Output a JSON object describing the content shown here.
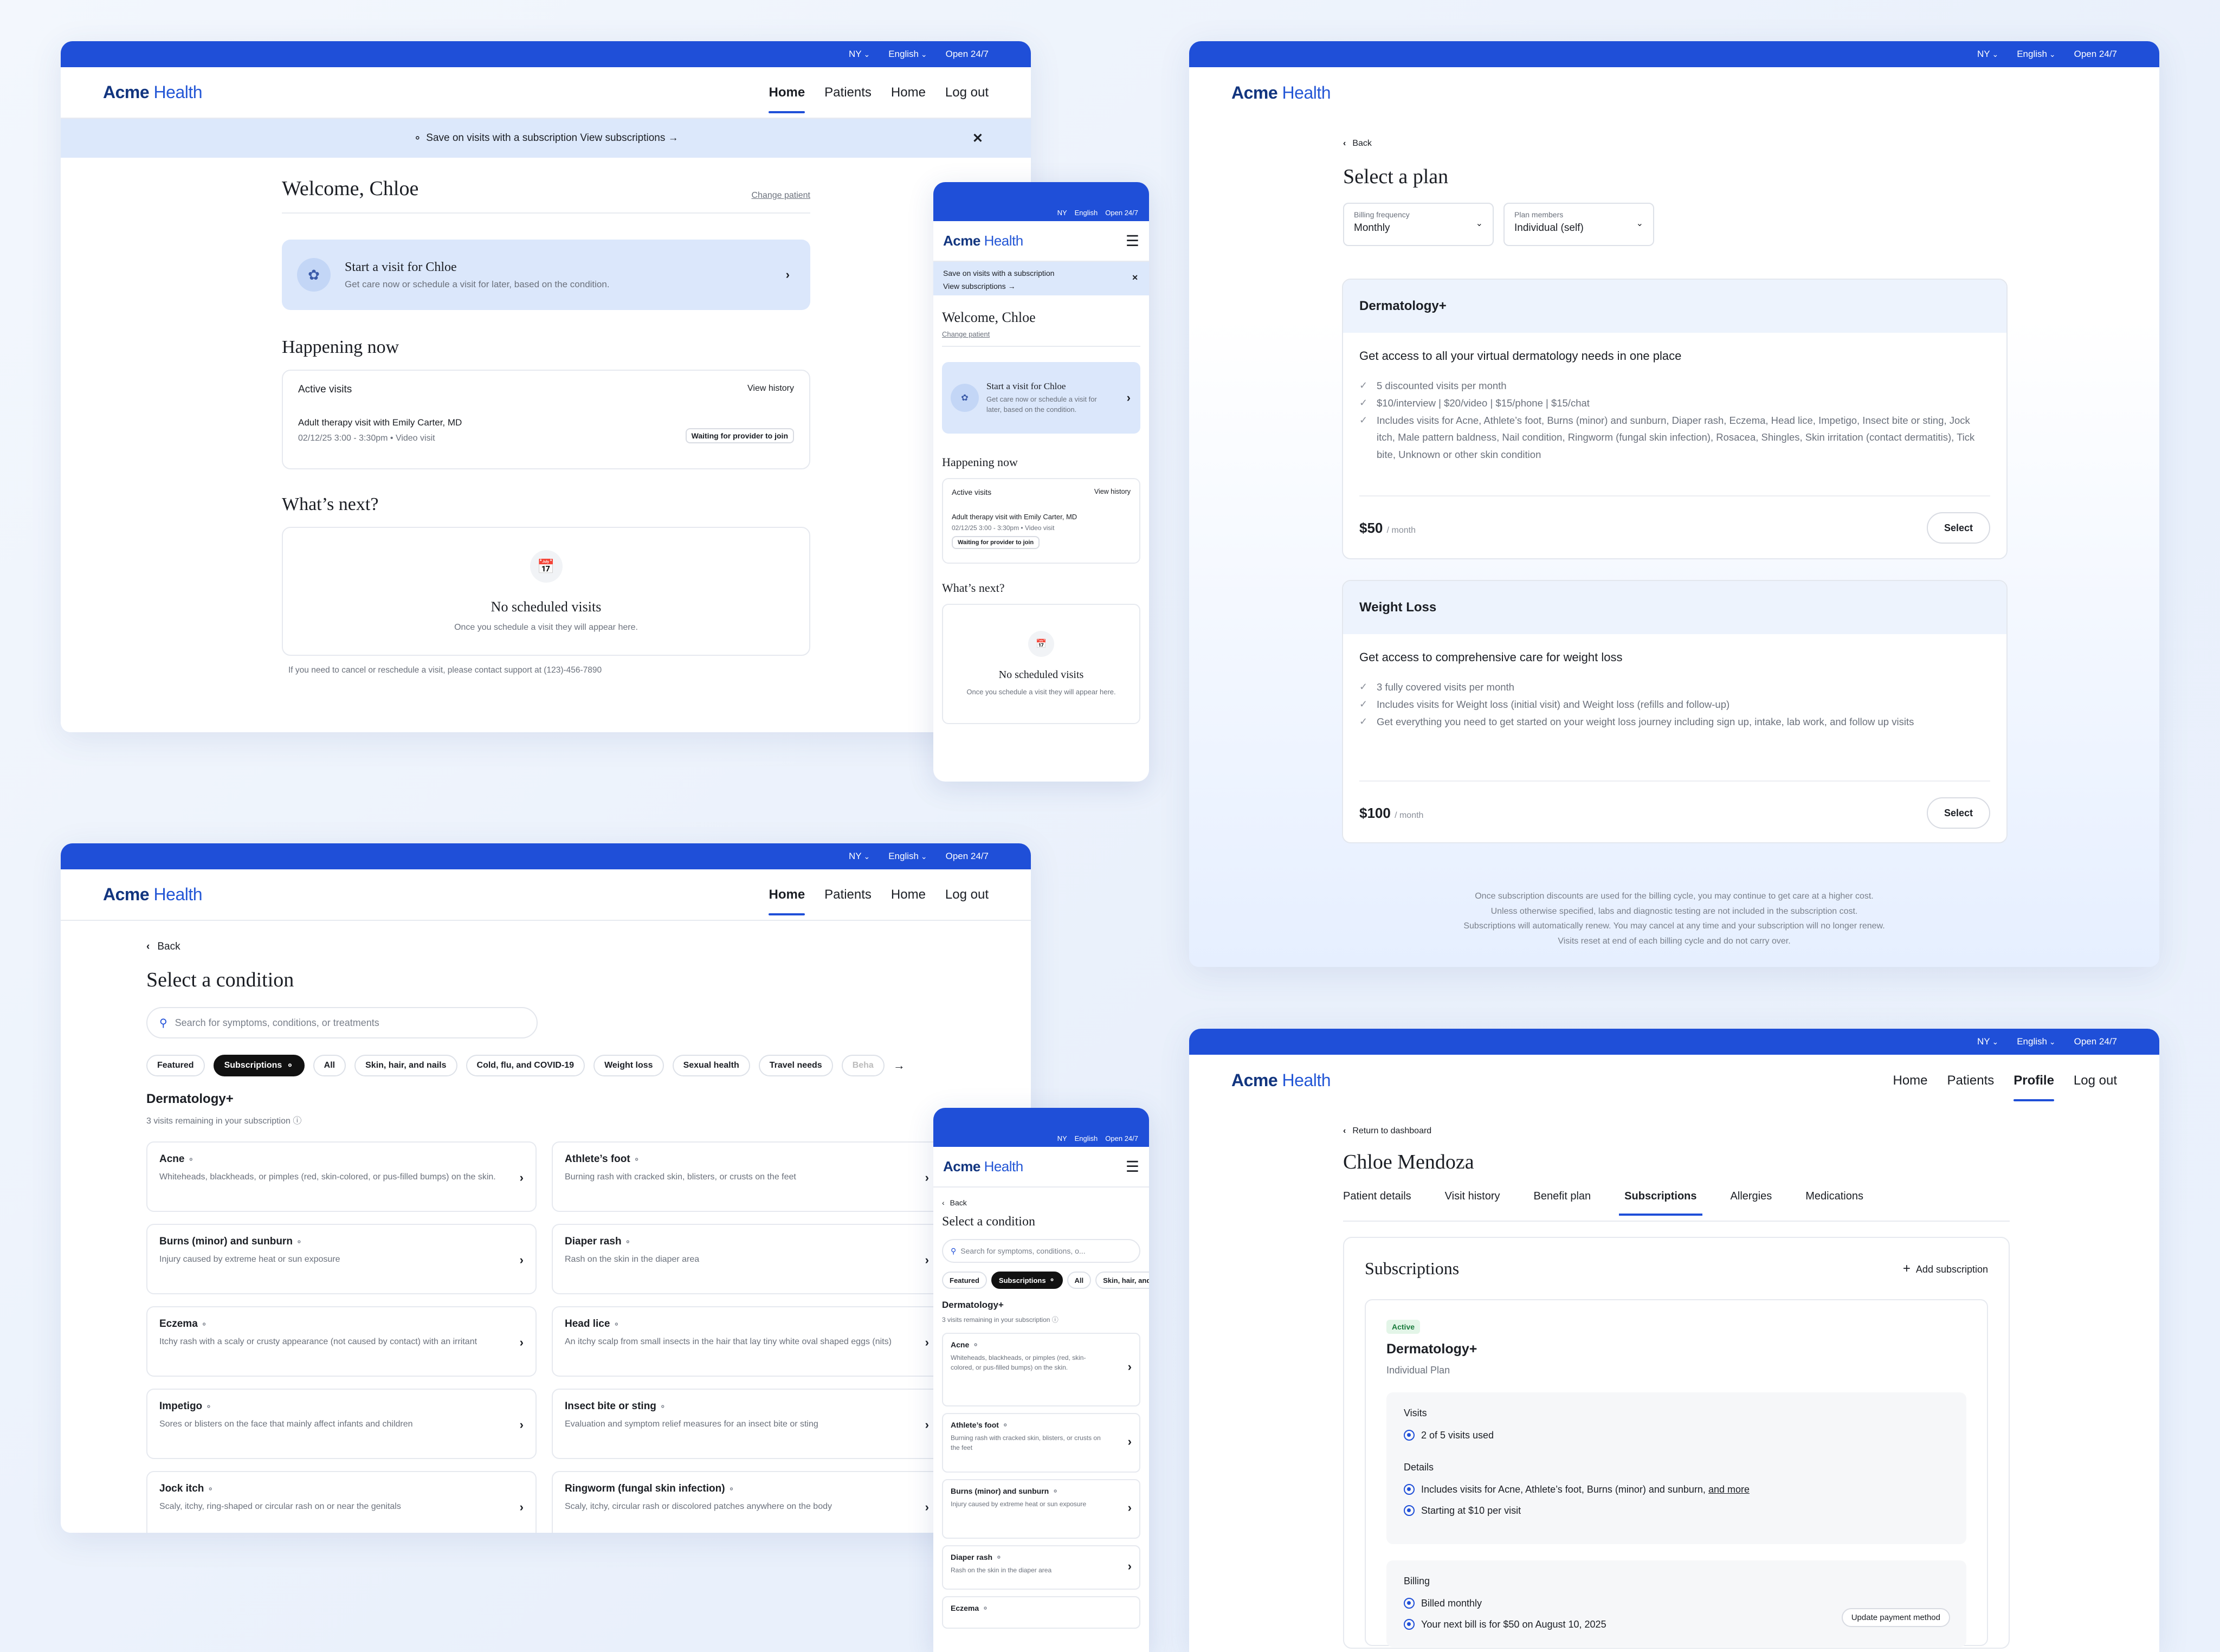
{
  "topbar": {
    "state": "NY",
    "language": "English",
    "hours": "Open 24/7"
  },
  "brand": {
    "name_bold": "Acme",
    "name_light": "Health"
  },
  "nav": {
    "home": "Home",
    "patients": "Patients",
    "home2": "Home",
    "logout": "Log out",
    "profile": "Profile"
  },
  "dashboard": {
    "banner": "Save on visits with a subscription View subscriptions →",
    "welcome": "Welcome, Chloe",
    "change_patient": "Change patient",
    "start_title": "Start a visit for Chloe",
    "start_sub": "Get care now or schedule a visit for later, based on the condition.",
    "happening": "Happening now",
    "active_visits": "Active visits",
    "view_history": "View history",
    "visit_title": "Adult therapy visit with Emily Carter, MD",
    "visit_meta": "02/12/25 3:00 - 3:30pm • Video visit",
    "visit_status": "Waiting for provider to join",
    "whats_next": "What’s next?",
    "no_visits": "No scheduled visits",
    "no_visits_sub": "Once you schedule a visit they will appear here.",
    "support": "If you need to cancel or reschedule a visit, please contact support at (123)-456-7890"
  },
  "mobile_dash": {
    "banner_l1": "Save on visits with a subscription",
    "banner_l2": "View subscriptions →"
  },
  "plans": {
    "back": "Back",
    "title": "Select a plan",
    "freq_label": "Billing frequency",
    "freq_value": "Monthly",
    "members_label": "Plan members",
    "members_value": "Individual (self)",
    "derm": {
      "name": "Dermatology+",
      "headline": "Get access to all your virtual dermatology needs in one place",
      "b1": "5 discounted visits per month",
      "b2": "$10/interview | $20/video | $15/phone | $15/chat",
      "b3": "Includes visits for Acne, Athlete’s foot, Burns (minor) and sunburn, Diaper rash, Eczema, Head lice, Impetigo, Insect bite or sting, Jock itch, Male pattern baldness, Nail condition, Ringworm (fungal skin infection), Rosacea, Shingles, Skin irritation (contact dermatitis), Tick bite, Unknown or other skin condition",
      "price": "$50",
      "per": "/ month"
    },
    "wl": {
      "name": "Weight Loss",
      "headline": "Get access to comprehensive care for weight loss",
      "b1": "3 fully covered visits per month",
      "b2": "Includes visits for Weight loss (initial visit) and Weight loss (refills and follow-up)",
      "b3": "Get everything you need to get started on your weight loss journey including sign up, intake, lab work, and follow up visits",
      "price": "$100",
      "per": "/ month"
    },
    "select": "Select",
    "fine1": "Once subscription discounts are used for the billing cycle, you may continue to get care at a higher cost.",
    "fine2": "Unless otherwise specified, labs and diagnostic testing are not included in the subscription cost.",
    "fine3": "Subscriptions will automatically renew. You may cancel at any time and your subscription will no longer renew.",
    "fine4": "Visits reset at end of each billing cycle and do not carry over."
  },
  "conditions": {
    "back": "Back",
    "title": "Select a condition",
    "search_placeholder": "Search for symptoms, conditions, or treatments",
    "mobile_search": "Search for symptoms, conditions, o...",
    "filters": [
      "Featured",
      "Subscriptions",
      "All",
      "Skin, hair, and nails",
      "Cold, flu, and COVID-19",
      "Weight loss",
      "Sexual health",
      "Travel needs",
      "Beha"
    ],
    "section": "Dermatology+",
    "remaining": "3 visits remaining in your subscription",
    "items": [
      {
        "name": "Acne",
        "desc": "Whiteheads, blackheads, or pimples (red, skin-colored, or pus-filled bumps) on the skin."
      },
      {
        "name": "Athlete’s foot",
        "desc": "Burning rash with cracked skin, blisters, or crusts on the feet"
      },
      {
        "name": "Burns (minor) and sunburn",
        "desc": "Injury caused by extreme heat or sun exposure"
      },
      {
        "name": "Diaper rash",
        "desc": "Rash on the skin in the diaper area"
      },
      {
        "name": "Eczema",
        "desc": "Itchy rash with a scaly or crusty appearance (not caused by contact) with an irritant"
      },
      {
        "name": "Head lice",
        "desc": "An itchy scalp from small insects in the hair that lay tiny white oval shaped eggs (nits)"
      },
      {
        "name": "Impetigo",
        "desc": "Sores or blisters on the face that mainly affect infants and children"
      },
      {
        "name": "Insect bite or sting",
        "desc": "Evaluation and symptom relief measures for an insect bite or sting"
      },
      {
        "name": "Jock itch",
        "desc": "Scaly, itchy, ring-shaped or circular rash on or near the genitals"
      },
      {
        "name": "Ringworm (fungal skin infection)",
        "desc": "Scaly, itchy, circular rash or discolored patches anywhere on the body"
      }
    ],
    "mobile_items": [
      {
        "name": "Acne",
        "desc": "Whiteheads, blackheads, or pimples (red, skin-colored, or pus-filled bumps) on the skin."
      },
      {
        "name": "Athlete’s foot",
        "desc": "Burning rash with cracked skin, blisters, or crusts on the feet"
      },
      {
        "name": "Burns (minor) and sunburn",
        "desc": "Injury caused by extreme heat or sun exposure"
      },
      {
        "name": "Diaper rash",
        "desc": "Rash on the skin in the diaper area"
      },
      {
        "name": "Eczema",
        "desc": ""
      }
    ]
  },
  "profile": {
    "return": "Return to dashboard",
    "name": "Chloe Mendoza",
    "tabs": [
      "Patient details",
      "Visit history",
      "Benefit plan",
      "Subscriptions",
      "Allergies",
      "Medications"
    ],
    "subs_title": "Subscriptions",
    "add": "Add subscription",
    "status": "Active",
    "plan": "Dermatology+",
    "plan_type": "Individual Plan",
    "visits_label": "Visits",
    "visits_used": "2 of 5 visits used",
    "details_label": "Details",
    "details_1": "Includes visits for Acne, Athlete’s foot, Burns (minor) and sunburn,",
    "and_more": "and more",
    "details_2": "Starting at $10 per visit",
    "billing_label": "Billing",
    "billing_1": "Billed monthly",
    "billing_2": "Your next bill is for $50 on August 10, 2025",
    "update_payment": "Update payment method"
  },
  "colors": {
    "primary": "#1f4fd8",
    "brand_dark": "#12357f",
    "banner": "#dce8fb",
    "card_tint": "#e1ecfc"
  }
}
